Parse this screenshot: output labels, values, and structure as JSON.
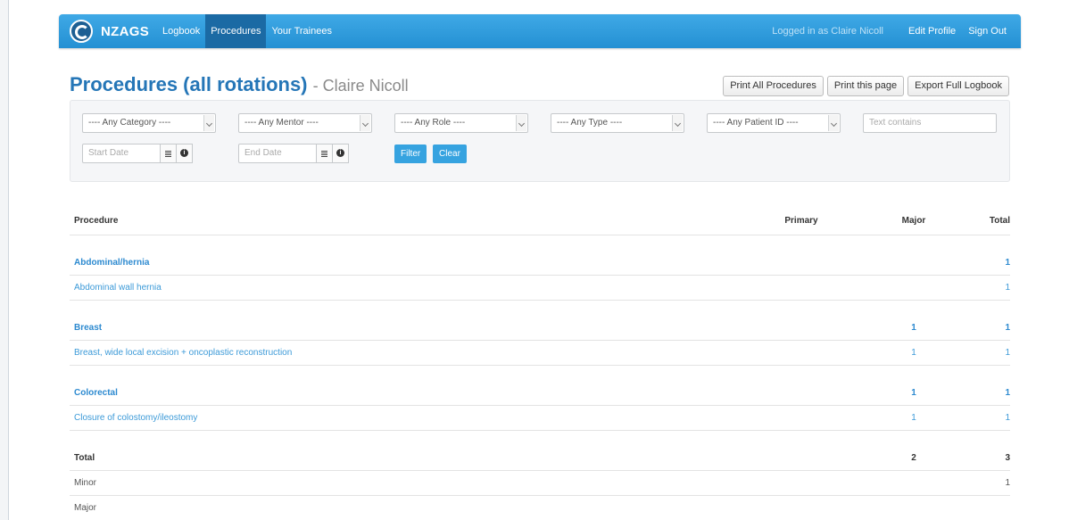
{
  "navbar": {
    "brand": "NZAGS",
    "items": [
      {
        "label": "Logbook",
        "active": false
      },
      {
        "label": "Procedures",
        "active": true
      },
      {
        "label": "Your Trainees",
        "active": false
      }
    ],
    "logged_in": "Logged in as Claire Nicoll",
    "edit_profile": "Edit Profile",
    "sign_out": "Sign Out"
  },
  "page": {
    "title": "Procedures (all rotations)",
    "subtitle": "- Claire Nicoll"
  },
  "buttons": {
    "print_all": "Print All Procedures",
    "print_page": "Print this page",
    "export": "Export Full Logbook"
  },
  "filters": {
    "category": "---- Any Category ----",
    "mentor": "---- Any Mentor ----",
    "role": "---- Any Role ----",
    "type": "---- Any Type ----",
    "patient": "---- Any Patient ID ----",
    "text_placeholder": "Text contains",
    "start_date": "Start Date",
    "end_date": "End Date",
    "filter_btn": "Filter",
    "clear_btn": "Clear"
  },
  "table": {
    "headers": {
      "procedure": "Procedure",
      "primary": "Primary",
      "major": "Major",
      "total": "Total"
    },
    "groups": [
      {
        "name": "Abdominal/hernia",
        "primary": "",
        "major": "",
        "total": "1",
        "items": [
          {
            "name": "Abdominal wall hernia",
            "primary": "",
            "major": "",
            "total": "1"
          }
        ]
      },
      {
        "name": "Breast",
        "primary": "",
        "major": "1",
        "total": "1",
        "items": [
          {
            "name": "Breast, wide local excision + oncoplastic reconstruction",
            "primary": "",
            "major": "1",
            "total": "1"
          }
        ]
      },
      {
        "name": "Colorectal",
        "primary": "",
        "major": "1",
        "total": "1",
        "items": [
          {
            "name": "Closure of colostomy/ileostomy",
            "primary": "",
            "major": "1",
            "total": "1"
          }
        ]
      }
    ],
    "totals": [
      {
        "name": "Total",
        "primary": "",
        "major": "2",
        "total": "3"
      },
      {
        "name": "Minor",
        "primary": "",
        "major": "",
        "total": "1"
      },
      {
        "name": "Major",
        "primary": "",
        "major": "",
        "total": ""
      }
    ]
  },
  "colors": {
    "nav": "#2490d3",
    "nav_active": "#1b6aa4",
    "link": "#2d8ad0",
    "primary_btn": "#36a3e0"
  }
}
